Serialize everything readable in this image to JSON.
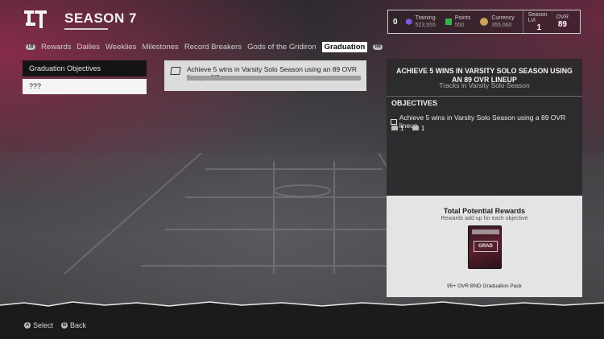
{
  "header": {
    "season_title": "SEASON 7"
  },
  "stats": {
    "count": "0",
    "training_label": "Training",
    "training_value": "523,555",
    "points_label": "Points",
    "points_value": "550",
    "currency_label": "Currency",
    "currency_value": "355,660",
    "season_lvl_label": "Season Lvl",
    "season_lvl_value": "1",
    "ovr_label": "OVR",
    "ovr_value": "89",
    "training_color": "#7a5be0",
    "points_color": "#2db84a",
    "currency_color": "#c9a35a"
  },
  "tabs": {
    "left_bumper": "LB",
    "right_bumper": "RB",
    "items": [
      "Rewards",
      "Dailies",
      "Weeklies",
      "Milestones",
      "Record Breakers",
      "Gods of the Gridiron",
      "Graduation"
    ],
    "active": "Graduation"
  },
  "left_panel": {
    "heading": "Graduation Objectives",
    "item": "???"
  },
  "objective_card": {
    "text": "Achieve 5 wins in Varsity Solo Season using an 89 OVR lineup",
    "progress": "0/5",
    "progress_fraction": 0
  },
  "detail": {
    "title": "ACHIEVE 5 WINS IN VARSITY SOLO SEASON USING AN 89 OVR LINEUP",
    "subtitle": "Tracks in Varsity Solo Season",
    "objectives_heading": "OBJECTIVES",
    "objective": "Achieve 5 wins in Varsity Solo Season using a 89 OVR lineup",
    "reward_1": "1",
    "reward_2": "1",
    "rewards_heading": "Total Potential Rewards",
    "rewards_sub": "Rewards add up for each objective",
    "pack_label": "GRAD",
    "pack_name": "95+ OVR BND Graduation Pack"
  },
  "footer": {
    "select_btn": "A",
    "select_label": "Select",
    "back_btn": "B",
    "back_label": "Back"
  }
}
